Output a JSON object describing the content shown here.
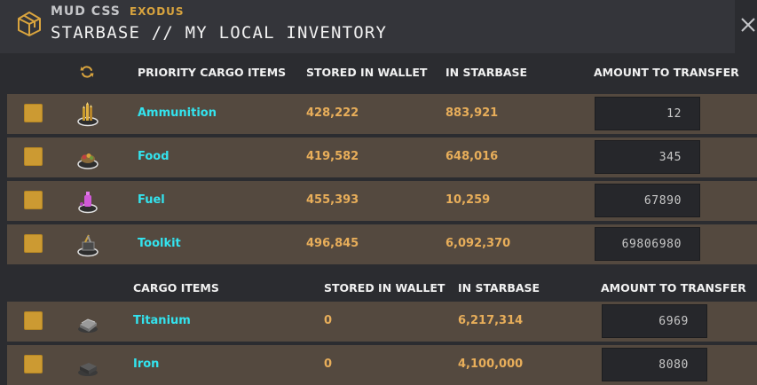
{
  "header": {
    "org": "MUD CSS",
    "faction": "EXODUS",
    "title": "STARBASE // MY LOCAL INVENTORY"
  },
  "priority_table": {
    "headers": {
      "item": "PRIORITY CARGO ITEMS",
      "wallet": "STORED IN WALLET",
      "starbase": "IN STARBASE",
      "transfer": "AMOUNT TO TRANSFER"
    },
    "rows": [
      {
        "name": "Ammunition",
        "wallet": "428,222",
        "starbase": "883,921",
        "amount": "12",
        "icon": "ammunition-icon"
      },
      {
        "name": "Food",
        "wallet": "419,582",
        "starbase": "648,016",
        "amount": "345",
        "icon": "food-icon"
      },
      {
        "name": "Fuel",
        "wallet": "455,393",
        "starbase": "10,259",
        "amount": "67890",
        "icon": "fuel-icon"
      },
      {
        "name": "Toolkit",
        "wallet": "496,845",
        "starbase": "6,092,370",
        "amount": "69806980",
        "icon": "toolkit-icon"
      }
    ]
  },
  "cargo_table": {
    "headers": {
      "item": "CARGO ITEMS",
      "wallet": "STORED IN WALLET",
      "starbase": "IN STARBASE",
      "transfer": "AMOUNT TO TRANSFER"
    },
    "rows": [
      {
        "name": "Titanium",
        "wallet": "0",
        "starbase": "6,217,314",
        "amount": "6969",
        "icon": "titanium-icon"
      },
      {
        "name": "Iron",
        "wallet": "0",
        "starbase": "4,100,000",
        "amount": "8080",
        "icon": "iron-icon"
      }
    ]
  },
  "colors": {
    "accent": "#d9a43e",
    "row_bg": "#54493f",
    "item_name": "#33e3ee",
    "value": "#e8ae5a",
    "checkbox": "#cc9a32"
  }
}
